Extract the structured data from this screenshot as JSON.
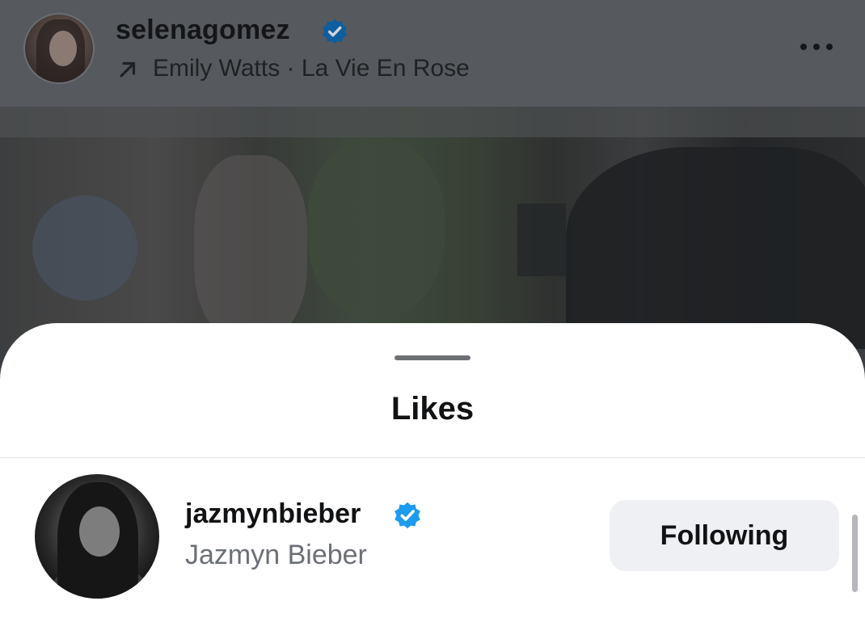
{
  "post": {
    "username": "selenagomez",
    "verified": true,
    "audio_artist": "Emily Watts",
    "audio_separator": " · ",
    "audio_track": "La Vie En Rose",
    "audio_line": "Emily Watts · La Vie En Rose",
    "more_icon": "more-horizontal-icon"
  },
  "likes_sheet": {
    "title": "Likes",
    "users": [
      {
        "handle": "jazmynbieber",
        "verified": true,
        "full_name": "Jazmyn Bieber",
        "button_label": "Following"
      }
    ]
  },
  "colors": {
    "verified_badge_dimmed": "#0d5e9e",
    "verified_badge": "#1d9bf0",
    "following_button_bg": "#eef0f3"
  }
}
